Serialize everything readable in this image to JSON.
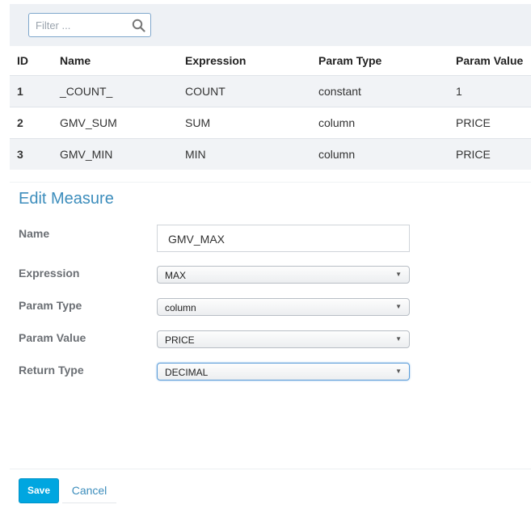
{
  "filter": {
    "placeholder": "Filter ...",
    "icon": "search-icon"
  },
  "table": {
    "headers": [
      "ID",
      "Name",
      "Expression",
      "Param Type",
      "Param Value"
    ],
    "rows": [
      {
        "id": "1",
        "name": "_COUNT_",
        "expression": "COUNT",
        "param_type": "constant",
        "param_value": "1"
      },
      {
        "id": "2",
        "name": "GMV_SUM",
        "expression": "SUM",
        "param_type": "column",
        "param_value": "PRICE"
      },
      {
        "id": "3",
        "name": "GMV_MIN",
        "expression": "MIN",
        "param_type": "column",
        "param_value": "PRICE"
      }
    ]
  },
  "edit": {
    "title": "Edit Measure",
    "name_label": "Name",
    "name_value": "GMV_MAX",
    "expression_label": "Expression",
    "expression_value": "MAX",
    "param_type_label": "Param Type",
    "param_type_value": "column",
    "param_value_label": "Param Value",
    "param_value_value": "PRICE",
    "return_type_label": "Return Type",
    "return_type_value": "DECIMAL"
  },
  "actions": {
    "save_label": "Save",
    "cancel_label": "Cancel"
  },
  "colors": {
    "accent": "#3c8dbc",
    "save_button": "#00a6e0",
    "row_stripe": "#f1f3f6"
  }
}
